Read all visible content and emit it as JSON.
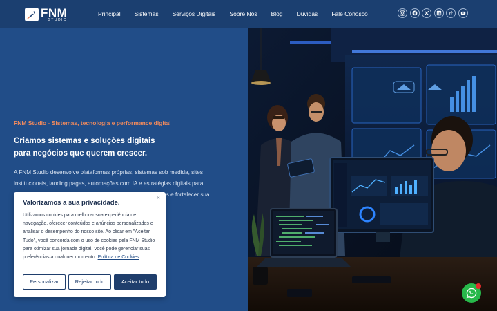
{
  "brand": {
    "name": "FNM",
    "sub": "STUDIO"
  },
  "nav": {
    "items": [
      {
        "label": "Principal",
        "active": true
      },
      {
        "label": "Sistemas"
      },
      {
        "label": "Serviços Digitais"
      },
      {
        "label": "Sobre Nós"
      },
      {
        "label": "Blog"
      },
      {
        "label": "Dúvidas"
      },
      {
        "label": "Fale Conosco"
      }
    ]
  },
  "social": [
    "instagram-icon",
    "facebook-icon",
    "x-icon",
    "linkedin-icon",
    "tiktok-icon",
    "youtube-icon"
  ],
  "hero": {
    "kicker": "FNM Studio - Sistemas, tecnologia e performance digital",
    "headline_1": "Criamos sistemas e soluções digitais",
    "headline_2": "para negócios que querem crescer.",
    "para_1": "A FNM Studio desenvolve plataformas próprias, sistemas sob medida, sites",
    "para_2": "institucionais, landing pages, automações com IA e estratégias digitais para",
    "para_3": "ssos e fortalecer sua"
  },
  "cookie": {
    "title": "Valorizamos a sua privacidade.",
    "text": "Utilizamos cookies para melhorar sua experiência de navegação, oferecer conteúdos e anúncios personalizados e analisar o desempenho do nosso site. Ao clicar em \"Aceitar Tudo\", você concorda com o uso de cookies pela FNM Studio para otimizar sua jornada digital. Você pode gerenciar suas preferências a qualquer momento.",
    "link": "Política de Cookies",
    "close": "×",
    "btn_personalize": "Personalizar",
    "btn_reject": "Rejeitar tudo",
    "btn_accept": "Aceitar tudo"
  },
  "colors": {
    "header": "#1b3f70",
    "hero": "#214d88",
    "accent": "#f08a5d",
    "whatsapp": "#27b84a"
  }
}
